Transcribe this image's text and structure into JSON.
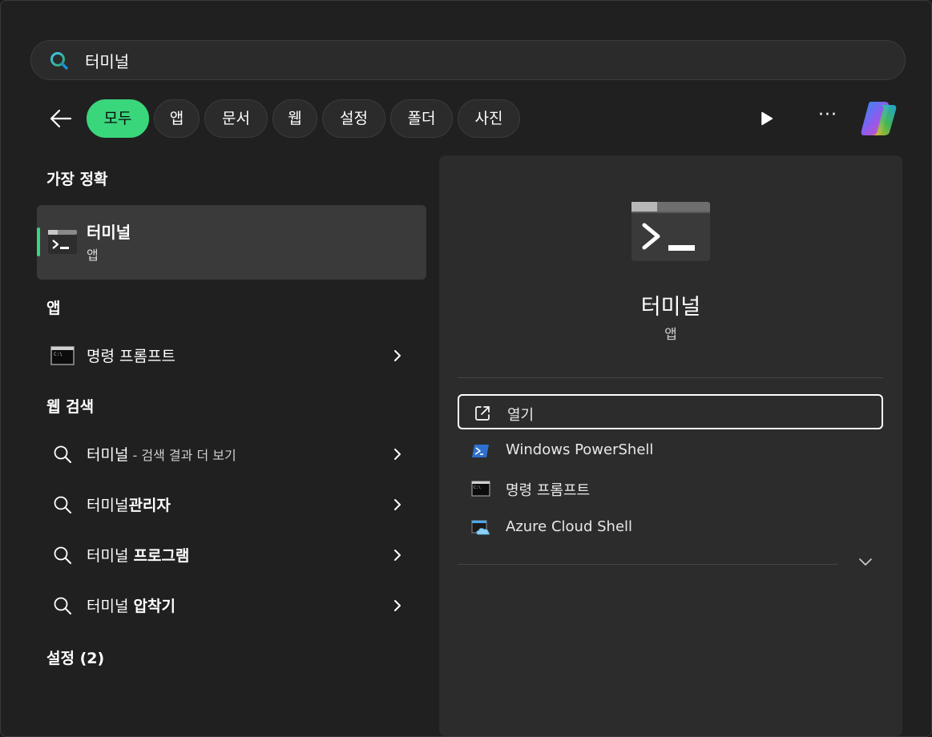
{
  "search": {
    "query": "터미널"
  },
  "filters": [
    {
      "label": "모두",
      "active": true
    },
    {
      "label": "앱",
      "active": false
    },
    {
      "label": "문서",
      "active": false
    },
    {
      "label": "웹",
      "active": false
    },
    {
      "label": "설정",
      "active": false
    },
    {
      "label": "폴더",
      "active": false
    },
    {
      "label": "사진",
      "active": false
    }
  ],
  "toolbar": {
    "more_label": "···"
  },
  "best_match": {
    "heading": "가장 정확",
    "title": "터미널",
    "subtitle": "앱"
  },
  "apps": {
    "heading": "앱",
    "items": [
      {
        "label": "명령 프롬프트"
      }
    ]
  },
  "web": {
    "heading": "웹 검색",
    "items": [
      {
        "prefix": "터미널",
        "suffix": " - 검색 결과 더 보기",
        "bold": ""
      },
      {
        "prefix": "터미널",
        "suffix": "",
        "bold": "관리자"
      },
      {
        "prefix": "터미널 ",
        "suffix": "",
        "bold": "프로그램"
      },
      {
        "prefix": "터미널 ",
        "suffix": "",
        "bold": "압착기"
      }
    ]
  },
  "settings": {
    "heading": "설정 (2)"
  },
  "preview": {
    "title": "터미널",
    "subtitle": "앱",
    "actions": [
      {
        "label": "열기",
        "icon": "open-external-icon"
      },
      {
        "label": "Windows PowerShell",
        "icon": "powershell-icon"
      },
      {
        "label": "명령 프롬프트",
        "icon": "command-prompt-icon"
      },
      {
        "label": "Azure Cloud Shell",
        "icon": "azure-cloud-shell-icon"
      }
    ]
  },
  "colors": {
    "accent": "#39d67c",
    "background": "#202020",
    "panel": "#2c2c2c",
    "selected": "#3a3a3a"
  }
}
